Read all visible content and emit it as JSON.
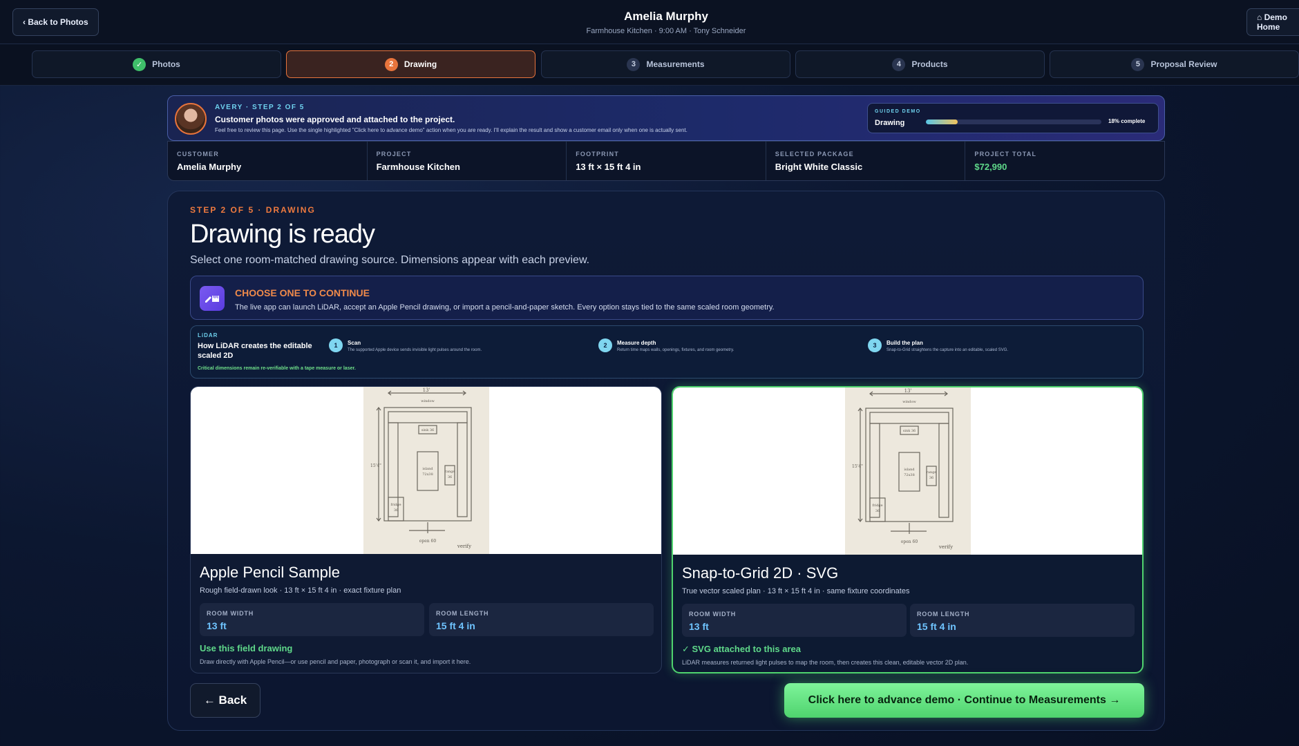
{
  "header": {
    "back_label": "‹ Back to Photos",
    "customer_name": "Amelia Murphy",
    "subtitle": "Farmhouse Kitchen · 9:00 AM · Tony Schneider",
    "demo_home_label": "⌂ Demo Home"
  },
  "steps": [
    {
      "num": "✓",
      "label": "Photos",
      "state": "done"
    },
    {
      "num": "2",
      "label": "Drawing",
      "state": "active"
    },
    {
      "num": "3",
      "label": "Measurements",
      "state": "upcoming"
    },
    {
      "num": "4",
      "label": "Products",
      "state": "upcoming"
    },
    {
      "num": "5",
      "label": "Proposal Review",
      "state": "upcoming"
    }
  ],
  "banner": {
    "eyebrow": "AVERY · STEP 2 OF 5",
    "title": "Customer photos were approved and attached to the project.",
    "description": "Feel free to review this page. Use the single highlighted \"Click here to advance demo\" action when you are ready. I'll explain the result and show a customer email only when one is actually sent.",
    "guided_eyebrow": "GUIDED DEMO",
    "guided_title": "Drawing",
    "progress_fraction": 0.18,
    "progress_label": "18% complete"
  },
  "summary": [
    {
      "label": "CUSTOMER",
      "value": "Amelia Murphy"
    },
    {
      "label": "PROJECT",
      "value": "Farmhouse Kitchen"
    },
    {
      "label": "FOOTPRINT",
      "value": "13 ft × 15 ft 4 in"
    },
    {
      "label": "SELECTED PACKAGE",
      "value": "Bright White Classic"
    },
    {
      "label": "PROJECT TOTAL",
      "value": "$72,990"
    }
  ],
  "main": {
    "eyebrow": "STEP 2 OF 5 · DRAWING",
    "title": "Drawing is ready",
    "subtitle": "Select one room-matched drawing source. Dimensions appear with each preview.",
    "choose_title": "CHOOSE ONE TO CONTINUE",
    "choose_desc": "The live app can launch LiDAR, accept an Apple Pencil drawing, or import a pencil-and-paper sketch. Every option stays tied to the same scaled room geometry."
  },
  "lidar": {
    "eyebrow": "LiDAR",
    "title": "How LiDAR creates the editable scaled 2D",
    "note": "Critical dimensions remain re-verifiable with a tape measure or laser.",
    "steps": [
      {
        "num": "1",
        "title": "Scan",
        "desc": "The supported Apple device sends invisible light pulses around the room."
      },
      {
        "num": "2",
        "title": "Measure depth",
        "desc": "Return time maps walls, openings, fixtures, and room geometry."
      },
      {
        "num": "3",
        "title": "Build the plan",
        "desc": "Snap-to-Grid straightens the capture into an editable, scaled SVG."
      }
    ]
  },
  "sketch_labels": {
    "top": "13'",
    "window": "window",
    "sink": "sink 36",
    "side": "15'4\"",
    "island": "island",
    "island_size": "72x38",
    "range": "range",
    "range_size": "36",
    "fridge": "fridge",
    "fridge_size": "36",
    "open": "open 60",
    "verify": "verify"
  },
  "options": [
    {
      "title": "Apple Pencil Sample",
      "desc": "Rough field-drawn look · 13 ft × 15 ft 4 in · exact fixture plan",
      "width_label": "ROOM WIDTH",
      "width_value": "13 ft",
      "length_label": "ROOM LENGTH",
      "length_value": "15 ft 4 in",
      "cta": "Use this field drawing",
      "note": "Draw directly with Apple Pencil—or use pencil and paper, photograph or scan it, and import it here.",
      "selected": false
    },
    {
      "title": "Snap-to-Grid 2D · SVG",
      "desc": "True vector scaled plan · 13 ft × 15 ft 4 in · same fixture coordinates",
      "width_label": "ROOM WIDTH",
      "width_value": "13 ft",
      "length_label": "ROOM LENGTH",
      "length_value": "15 ft 4 in",
      "cta": "✓ SVG attached to this area",
      "note": "LiDAR measures returned light pulses to map the room, then creates this clean, editable vector 2D plan.",
      "selected": true
    }
  ],
  "actions": {
    "back_label": "← Back",
    "advance_label": "Click here to advance demo · Continue to Measurements →"
  },
  "colors": {
    "accent_orange": "#e8743c",
    "accent_green": "#4fd36e",
    "accent_cyan": "#6fd3ef"
  }
}
